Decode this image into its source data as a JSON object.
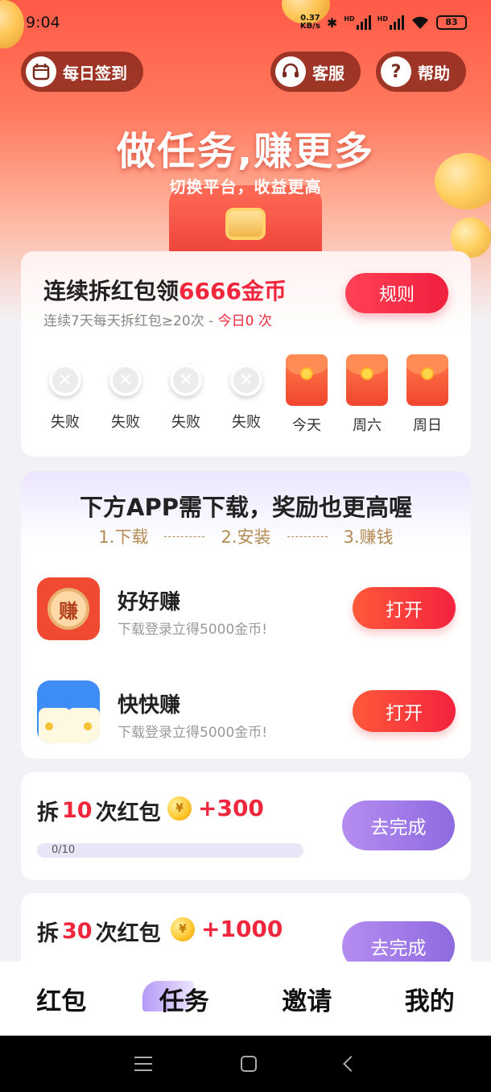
{
  "status_bar": {
    "time": "9:04",
    "net_speed_value": "0.37",
    "net_speed_unit": "KB/s",
    "hd1": "HD",
    "hd2": "HD",
    "battery": "83"
  },
  "header": {
    "checkin_label": "每日签到",
    "service_label": "客服",
    "help_label": "帮助",
    "help_icon_glyph": "?",
    "title": "做任务,赚更多",
    "subtitle": "切换平台，收益更高"
  },
  "streak": {
    "title_prefix": "连续拆红包领",
    "title_highlight": "6666金币",
    "sub_prefix": "连续7天每天拆红包≥20次 - ",
    "sub_highlight": "今日0 次",
    "rule_label": "规则",
    "days": [
      {
        "label": "失败",
        "state": "fail"
      },
      {
        "label": "失败",
        "state": "fail"
      },
      {
        "label": "失败",
        "state": "fail"
      },
      {
        "label": "失败",
        "state": "fail"
      },
      {
        "label": "今天",
        "state": "pending"
      },
      {
        "label": "周六",
        "state": "pending"
      },
      {
        "label": "周日",
        "state": "pending"
      }
    ]
  },
  "apps": {
    "title": "下方APP需下载，奖励也更高喔",
    "steps": [
      "1.下载",
      "2.安装",
      "3.赚钱"
    ],
    "items": [
      {
        "name": "好好赚",
        "desc": "下载登录立得5000金币!",
        "icon_text": "赚",
        "button": "打开"
      },
      {
        "name": "快快赚",
        "desc": "下载登录立得5000金币!",
        "button": "打开"
      }
    ]
  },
  "tasks": [
    {
      "prefix": "拆",
      "count": "10",
      "suffix": "次红包",
      "reward": "+300",
      "coin_glyph": "¥",
      "progress_text": "0/10",
      "progress": 0,
      "button": "去完成"
    },
    {
      "prefix": "拆",
      "count": "30",
      "suffix": "次红包",
      "reward": "+1000",
      "coin_glyph": "¥",
      "button": "去完成"
    }
  ],
  "tabs": [
    {
      "label": "红包",
      "active": false
    },
    {
      "label": "任务",
      "active": true
    },
    {
      "label": "邀请",
      "active": false
    },
    {
      "label": "我的",
      "active": false
    }
  ],
  "colors": {
    "accent_red": "#f0263c",
    "accent_purple": "#9a76e6",
    "step_gold": "#b38a52"
  }
}
